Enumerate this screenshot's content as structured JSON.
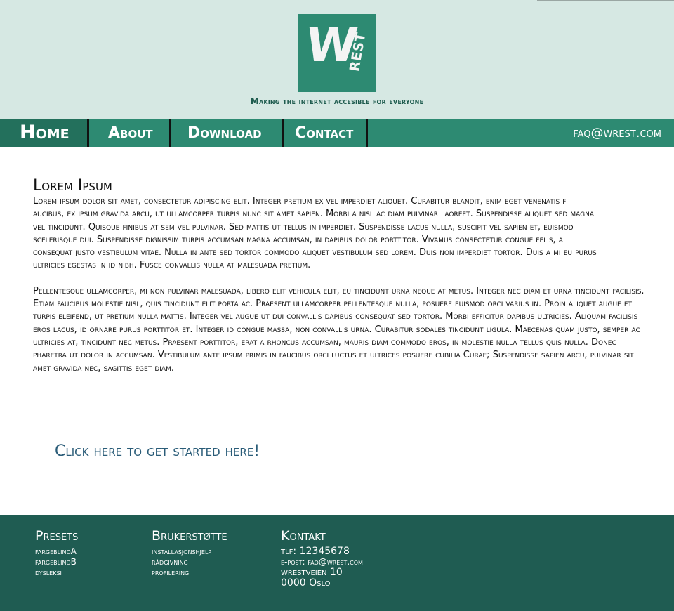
{
  "logo": {
    "letter": "W",
    "sub": "REST"
  },
  "tagline": "Making the internet accesible for everyone",
  "nav": {
    "home": "Home",
    "about": "About",
    "download": "Download",
    "contact": "Contact",
    "email": "faq@wrest.com"
  },
  "main": {
    "title": "Lorem Ipsum",
    "paragraph1": "Lorem ipsum dolor sit amet, consectetur adipiscing elit. Integer pretium ex vel imperdiet aliquet. Curabitur blandit, enim eget venenatis f aucibus, ex ipsum gravida arcu, ut ullamcorper turpis nunc sit amet sapien. Morbi a nisl ac diam pulvinar laoreet. Suspendisse aliquet sed magna vel tincidunt. Quisque finibus at sem vel pulvinar. Sed mattis ut tellus in imperdiet. Suspendisse lacus nulla, suscipit vel sapien et, euismod scelerisque dui. Suspendisse dignissim turpis accumsan magna accumsan, in dapibus dolor porttitor. Vivamus consectetur congue felis, a consequat justo vestibulum vitae. Nulla in ante sed tortor commodo aliquet vestibulum sed lorem. Duis non imperdiet tortor. Duis a mi eu purus ultricies egestas in id nibh. Fusce convallis nulla at malesuada pretium.",
    "paragraph2": "Pellentesque ullamcorper, mi non pulvinar malesuada, libero elit vehicula elit, eu tincidunt urna neque at metus. Integer nec diam et urna tincidunt facilisis. Etiam faucibus molestie nisl, quis tincidunt elit porta ac. Praesent ullamcorper pellentesque nulla, posuere euismod orci varius in. Proin aliquet augue et turpis eleifend, ut pretium nulla mattis. Integer vel augue ut dui convallis dapibus consequat sed tortor. Morbi efficitur dapibus ultricies. Aliquam facilisis eros lacus, id ornare purus porttitor et. Integer id congue massa, non convallis urna. Curabitur sodales tincidunt ligula. Maecenas quam justo, semper ac ultricies at, tincidunt nec metus. Praesent porttitor, erat a rhoncus accumsan, mauris diam commodo eros, in molestie nulla tellus quis nulla. Donec pharetra ut dolor in accumsan. Vestibulum ante ipsum primis in faucibus orci luctus et ultrices posuere cubilia Curae; Suspendisse sapien arcu, pulvinar sit amet gravida nec, sagittis eget diam.",
    "cta": "Click here to get started here!"
  },
  "footer": {
    "presets": {
      "title": "Presets",
      "items": [
        "fargeblindA",
        "fargeblindB",
        "dysleksi"
      ]
    },
    "support": {
      "title": "Brukerstøtte",
      "items": [
        "installasjonshjelp",
        "rådgivning",
        "profilering"
      ]
    },
    "contact": {
      "title": "Kontakt",
      "phone": "tlf: 12345678",
      "email": "e-post: faq@wrest.com",
      "street": "wrestveien 10",
      "city": "0000 Oslo"
    }
  },
  "colors": {
    "header_bg": "#d6e8e3",
    "accent": "#2d8a72",
    "footer_bg": "#1f5c52",
    "cta": "#2a5c78"
  }
}
